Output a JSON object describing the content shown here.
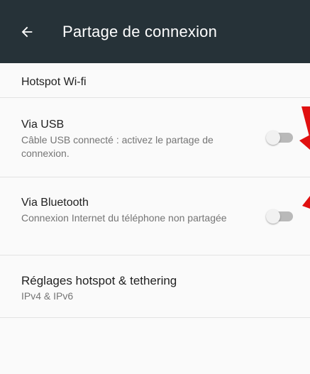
{
  "toolbar": {
    "title": "Partage de connexion",
    "background": "#263238",
    "back_icon": "arrow-left-icon"
  },
  "settings": {
    "hotspot": {
      "title": "Hotspot Wi-fi"
    },
    "usb": {
      "title": "Via USB",
      "summary": "Câble USB connecté : activez le partage de connexion.",
      "toggle_on": false
    },
    "bluetooth": {
      "title": "Via Bluetooth",
      "summary": "Connexion Internet du téléphone non partagée",
      "toggle_on": false
    },
    "tethering": {
      "title": "Réglages hotspot & tethering",
      "summary": "IPv4 & IPv6"
    }
  },
  "annotations": {
    "color": "#e01010",
    "icon": "red-arrow-icon"
  }
}
